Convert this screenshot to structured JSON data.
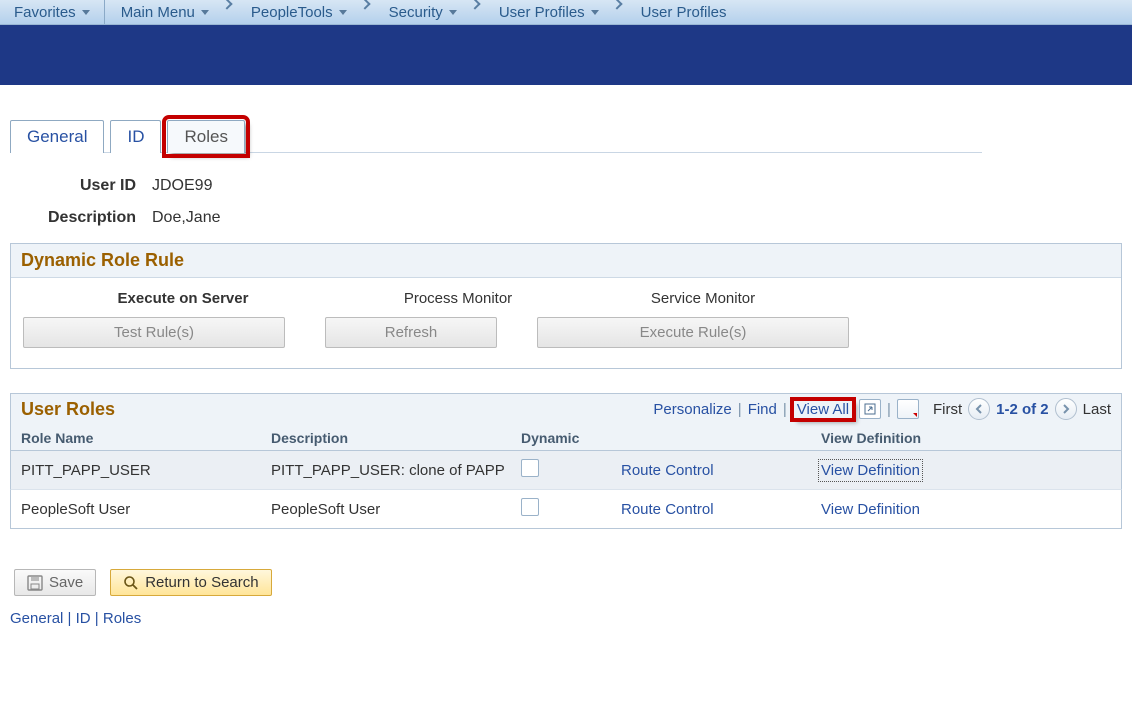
{
  "nav": {
    "favorites": "Favorites",
    "crumbs": [
      {
        "label": "Main Menu",
        "has_dropdown": true
      },
      {
        "label": "PeopleTools",
        "has_dropdown": true
      },
      {
        "label": "Security",
        "has_dropdown": true
      },
      {
        "label": "User Profiles",
        "has_dropdown": true
      },
      {
        "label": "User Profiles",
        "has_dropdown": false
      }
    ]
  },
  "tabs": {
    "items": [
      {
        "label": "General",
        "active": false,
        "highlighted": false
      },
      {
        "label": "ID",
        "active": false,
        "highlighted": false
      },
      {
        "label": "Roles",
        "active": true,
        "highlighted": true
      }
    ]
  },
  "form": {
    "user_id_label": "User ID",
    "user_id_value": "JDOE99",
    "description_label": "Description",
    "description_value": "Doe,Jane"
  },
  "dynamic_rule": {
    "title": "Dynamic Role Rule",
    "exec_on_server": "Execute on Server",
    "process_monitor": "Process Monitor",
    "service_monitor": "Service Monitor",
    "test_btn": "Test Rule(s)",
    "refresh_btn": "Refresh",
    "execute_btn": "Execute Rule(s)"
  },
  "user_roles": {
    "title": "User Roles",
    "tools": {
      "personalize": "Personalize",
      "find": "Find",
      "view_all": "View All"
    },
    "nav": {
      "first": "First",
      "range": "1-2 of 2",
      "last": "Last"
    },
    "columns": {
      "role_name": "Role Name",
      "description": "Description",
      "dynamic": "Dynamic",
      "view_definition": "View Definition"
    },
    "rows": [
      {
        "role_name": "PITT_PAPP_USER",
        "description": "PITT_PAPP_USER:  clone of PAPP",
        "dynamic": false,
        "route_control": "Route Control",
        "view_definition": "View Definition",
        "view_def_dotted": true
      },
      {
        "role_name": "PeopleSoft User",
        "description": "PeopleSoft User",
        "dynamic": false,
        "route_control": "Route Control",
        "view_definition": "View Definition",
        "view_def_dotted": false
      }
    ]
  },
  "bottom": {
    "save": "Save",
    "return": "Return to Search",
    "links": [
      "General",
      "ID",
      "Roles"
    ]
  }
}
